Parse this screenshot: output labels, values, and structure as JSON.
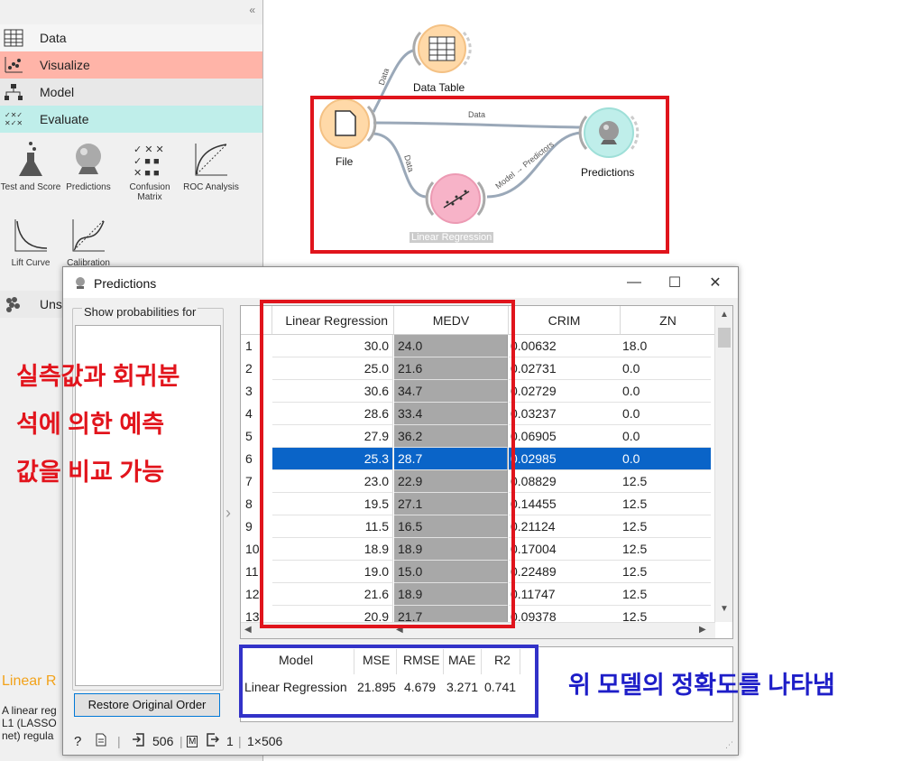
{
  "toolbox": {
    "categories": {
      "data": "Data",
      "visualize": "Visualize",
      "model": "Model",
      "evaluate": "Evaluate",
      "unsupervised": "Uns"
    },
    "widgets": {
      "test_score": "Test and Score",
      "predictions": "Predictions",
      "confusion": "Confusion Matrix",
      "roc": "ROC Analysis",
      "lift": "Lift Curve",
      "calibration": "Calibration"
    },
    "description": {
      "title": "Linear R",
      "text": "A linear reg\nL1 (LASSO\nnet) regula"
    }
  },
  "canvas": {
    "nodes": {
      "file": "File",
      "data_table": "Data Table",
      "linear_regression": "Linear Regression",
      "predictions": "Predictions"
    },
    "links": {
      "file_to_table": "Data",
      "file_to_predictions": "Data",
      "file_to_lr": "Data",
      "lr_to_predictions": "Model → Predictors"
    }
  },
  "dialog": {
    "title": "Predictions",
    "show_probabilities_label": "Show probabilities for",
    "restore_button": "Restore Original Order",
    "table": {
      "headers": [
        "Linear Regression",
        "MEDV",
        "CRIM",
        "ZN"
      ],
      "selected_row": 6,
      "rows": [
        {
          "n": "1",
          "pred": "30.0",
          "medv": "24.0",
          "crim": "0.00632",
          "zn": "18.0"
        },
        {
          "n": "2",
          "pred": "25.0",
          "medv": "21.6",
          "crim": "0.02731",
          "zn": "0.0"
        },
        {
          "n": "3",
          "pred": "30.6",
          "medv": "34.7",
          "crim": "0.02729",
          "zn": "0.0"
        },
        {
          "n": "4",
          "pred": "28.6",
          "medv": "33.4",
          "crim": "0.03237",
          "zn": "0.0"
        },
        {
          "n": "5",
          "pred": "27.9",
          "medv": "36.2",
          "crim": "0.06905",
          "zn": "0.0"
        },
        {
          "n": "6",
          "pred": "25.3",
          "medv": "28.7",
          "crim": "0.02985",
          "zn": "0.0"
        },
        {
          "n": "7",
          "pred": "23.0",
          "medv": "22.9",
          "crim": "0.08829",
          "zn": "12.5"
        },
        {
          "n": "8",
          "pred": "19.5",
          "medv": "27.1",
          "crim": "0.14455",
          "zn": "12.5"
        },
        {
          "n": "9",
          "pred": "11.5",
          "medv": "16.5",
          "crim": "0.21124",
          "zn": "12.5"
        },
        {
          "n": "10",
          "pred": "18.9",
          "medv": "18.9",
          "crim": "0.17004",
          "zn": "12.5"
        },
        {
          "n": "11",
          "pred": "19.0",
          "medv": "15.0",
          "crim": "0.22489",
          "zn": "12.5"
        },
        {
          "n": "12",
          "pred": "21.6",
          "medv": "18.9",
          "crim": "0.11747",
          "zn": "12.5"
        },
        {
          "n": "13",
          "pred": "20.9",
          "medv": "21.7",
          "crim": "0.09378",
          "zn": "12.5"
        }
      ]
    },
    "scores": {
      "headers": [
        "Model",
        "MSE",
        "RMSE",
        "MAE",
        "R2"
      ],
      "row": [
        "Linear Regression",
        "21.895",
        "4.679",
        "3.271",
        "0.741"
      ]
    },
    "status": {
      "input_count": "506",
      "output_count": "1",
      "shape": "1×506"
    }
  },
  "annotations": {
    "left": [
      "실측값과 회귀분",
      "석에 의한 예측",
      "값을 비교 가능"
    ],
    "right": "위 모델의 정확도를 나타냄"
  },
  "colors": {
    "visualize": "#ffb4a8",
    "evaluate": "#bfeeea",
    "selection": "#0a64c8",
    "annotation_red": "#e2141c",
    "annotation_blue": "#1e1ec8"
  }
}
